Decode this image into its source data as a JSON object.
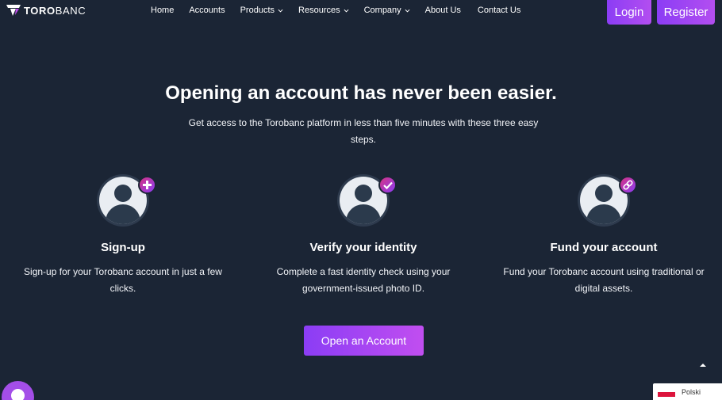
{
  "brand": {
    "name_bold": "TORO",
    "name_light": "BANC"
  },
  "nav": {
    "items": [
      {
        "label": "Home",
        "dropdown": false
      },
      {
        "label": "Accounts",
        "dropdown": false
      },
      {
        "label": "Products",
        "dropdown": true
      },
      {
        "label": "Resources",
        "dropdown": true
      },
      {
        "label": "Company",
        "dropdown": true
      },
      {
        "label": "About Us",
        "dropdown": false
      },
      {
        "label": "Contact Us",
        "dropdown": false
      }
    ],
    "login_label": "Login",
    "register_label": "Register"
  },
  "hero": {
    "title": "Opening an account has never been easier.",
    "subtitle": "Get access to the Torobanc platform in less than five minutes with these three easy steps."
  },
  "steps": [
    {
      "title": "Sign-up",
      "text": "Sign-up for your Torobanc account in just a few clicks.",
      "badge_icon": "plus-icon"
    },
    {
      "title": "Verify your identity",
      "text": "Complete a fast identity check using your government-issued photo ID.",
      "badge_icon": "check-icon"
    },
    {
      "title": "Fund your account",
      "text": "Fund your Torobanc account using traditional or digital assets.",
      "badge_icon": "link-icon"
    }
  ],
  "cta": {
    "label": "Open an Account"
  },
  "language": {
    "label": "Polski"
  },
  "colors": {
    "background": "#1b2535",
    "accent_start": "#8b3df5",
    "accent_end": "#c14ef0",
    "badge_pink": "#d63384"
  }
}
